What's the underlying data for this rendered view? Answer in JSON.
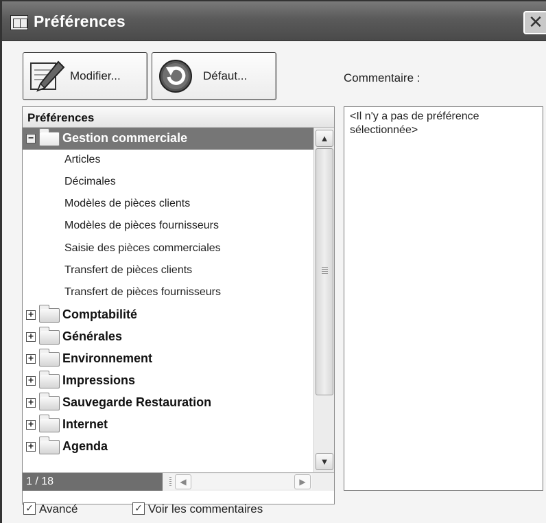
{
  "window": {
    "title": "Préférences",
    "close_glyph": "✕"
  },
  "toolbar": {
    "modify_label": "Modifier...",
    "default_label": "Défaut..."
  },
  "comment": {
    "caption": "Commentaire :",
    "text": "<Il n'y a pas de préférence sélectionnée>"
  },
  "tree": {
    "header": "Préférences",
    "rows": [
      {
        "kind": "group",
        "label": "Gestion commerciale",
        "expanded": true,
        "selected": true
      },
      {
        "kind": "leaf",
        "label": "Articles"
      },
      {
        "kind": "leaf",
        "label": "Décimales"
      },
      {
        "kind": "leaf",
        "label": "Modèles de pièces clients"
      },
      {
        "kind": "leaf",
        "label": "Modèles de pièces fournisseurs"
      },
      {
        "kind": "leaf",
        "label": "Saisie des pièces commerciales"
      },
      {
        "kind": "leaf",
        "label": "Transfert de pièces clients"
      },
      {
        "kind": "leaf",
        "label": "Transfert de pièces fournisseurs"
      },
      {
        "kind": "group",
        "label": "Comptabilité",
        "expanded": false
      },
      {
        "kind": "group",
        "label": "Générales",
        "expanded": false
      },
      {
        "kind": "group",
        "label": "Environnement",
        "expanded": false
      },
      {
        "kind": "group",
        "label": "Impressions",
        "expanded": false
      },
      {
        "kind": "group",
        "label": "Sauvegarde Restauration",
        "expanded": false
      },
      {
        "kind": "group",
        "label": "Internet",
        "expanded": false
      },
      {
        "kind": "group",
        "label": "Agenda",
        "expanded": false
      }
    ],
    "expanded_glyph": "−",
    "collapsed_glyph": "+",
    "counter": "1 / 18"
  },
  "footer": {
    "advanced_label": "Avancé",
    "advanced_checked": true,
    "show_comments_label": "Voir les commentaires",
    "show_comments_checked": true,
    "check_glyph": "✓"
  },
  "icons": {
    "modify": "pencil-edit-icon",
    "default": "reset-arrow-icon",
    "app": "preferences-app-icon"
  }
}
